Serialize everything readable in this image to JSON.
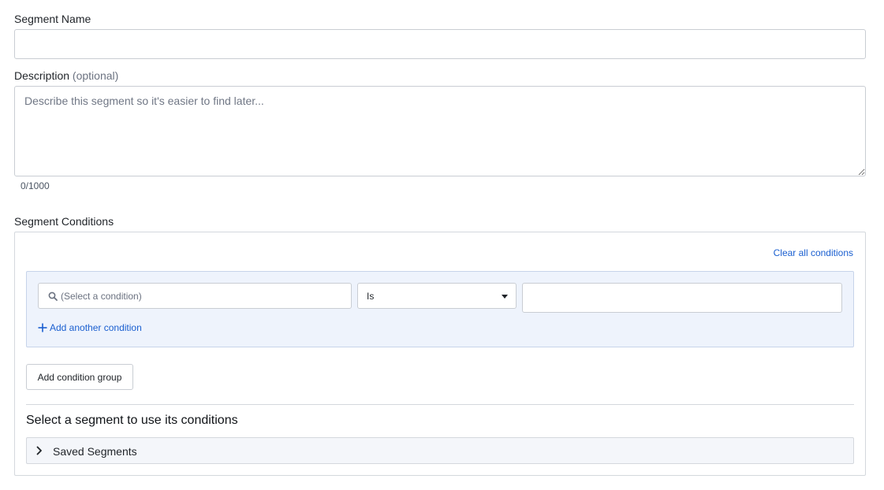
{
  "segment_name": {
    "label": "Segment Name",
    "value": ""
  },
  "description": {
    "label": "Description",
    "optional_label": "(optional)",
    "placeholder": "Describe this segment so it's easier to find later...",
    "value": "",
    "counter": "0/1000"
  },
  "conditions": {
    "label": "Segment Conditions",
    "clear_all_label": "Clear all conditions",
    "group": {
      "condition_placeholder": "(Select a condition)",
      "condition_icon": "search-icon",
      "operator_value": "Is",
      "value": "",
      "add_condition_label": "Add another condition",
      "add_condition_icon": "plus-icon"
    },
    "add_group_label": "Add condition group"
  },
  "saved": {
    "heading": "Select a segment to use its conditions",
    "accordion_label": "Saved Segments",
    "accordion_icon": "chevron-right-icon"
  },
  "colors": {
    "link": "#1a5fd0",
    "group_bg": "#eef3fc",
    "border": "#c9cdd3"
  }
}
